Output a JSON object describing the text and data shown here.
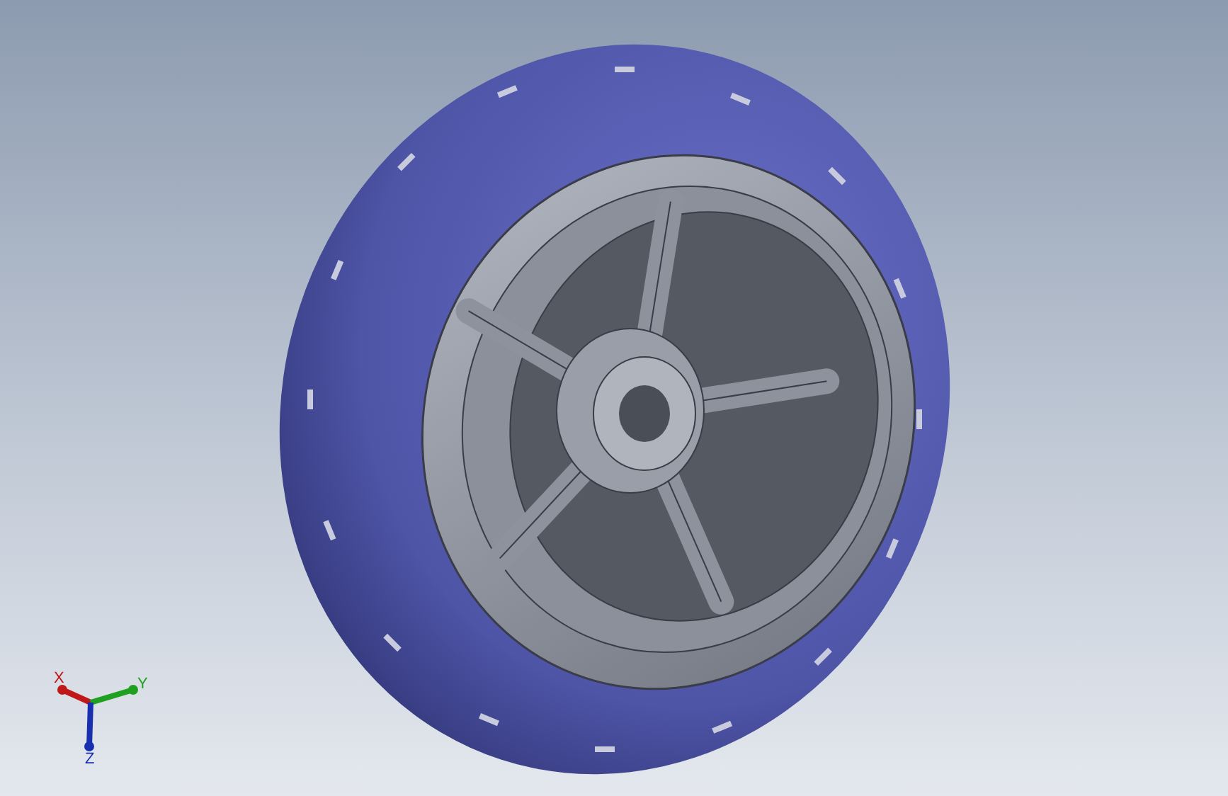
{
  "triad": {
    "axes": [
      {
        "kind": "x",
        "label": "X",
        "color": "#c01818"
      },
      {
        "kind": "y",
        "label": "Y",
        "color": "#20a020"
      },
      {
        "kind": "z",
        "label": "Z",
        "color": "#1830b0"
      }
    ]
  }
}
